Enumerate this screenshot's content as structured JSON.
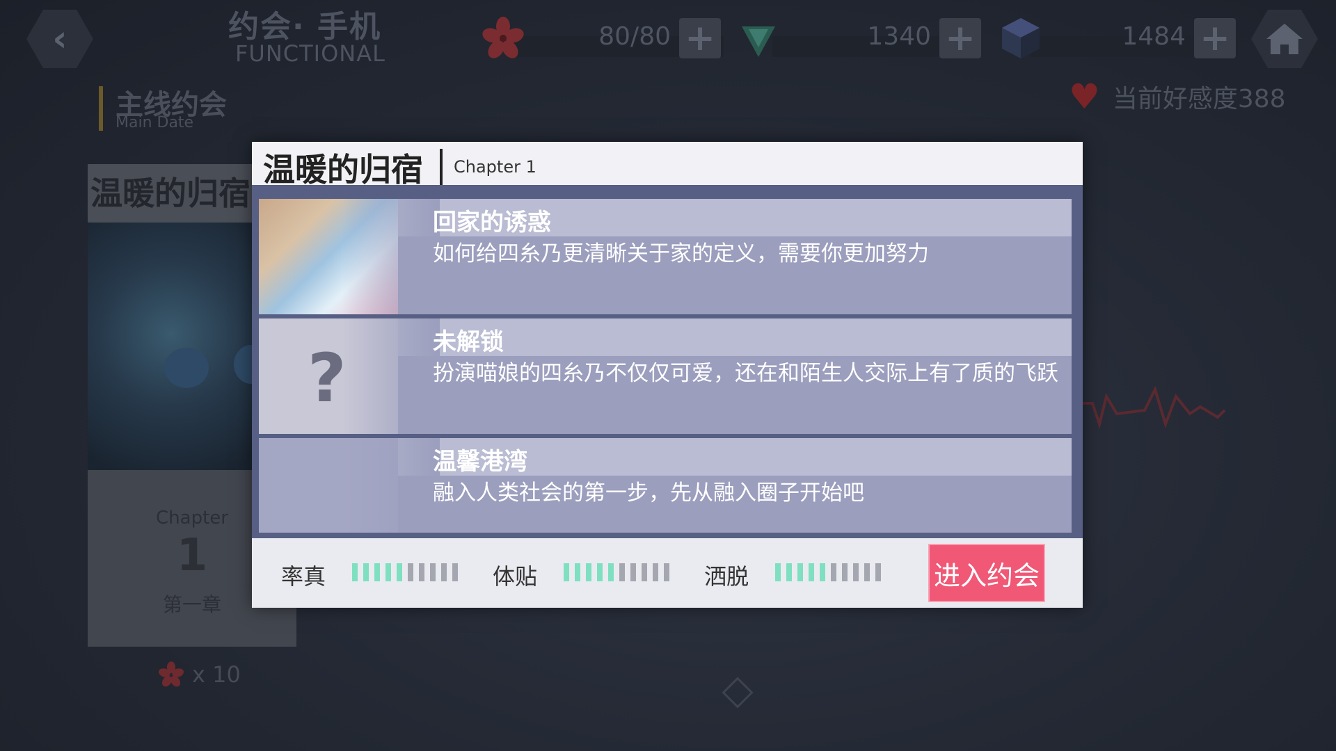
{
  "topbar": {
    "title_cn": "约会· 手机",
    "title_en": "FUNCTIONAL",
    "stamina": "80/80",
    "crystals": "1340",
    "cubes": "1484"
  },
  "section": {
    "title_cn": "主线约会",
    "title_en": "Main Date",
    "affection_label": "当前好感度388"
  },
  "chapter_card": {
    "title": "温暖的归宿",
    "chapter_label": "Chapter",
    "chapter_number": "1",
    "chapter_cn": "第一章",
    "cost": "x 10"
  },
  "modal": {
    "title": "温暖的归宿",
    "chapter": "Chapter 1",
    "episodes": [
      {
        "title": "回家的诱惑",
        "desc": "如何给四糸乃更清晰关于家的定义，需要你更加努力"
      },
      {
        "title": "未解锁",
        "desc": "扮演喵娘的四糸乃不仅仅可爱，还在和陌生人交际上有了质的飞跃"
      },
      {
        "title": "温馨港湾",
        "desc": "融入人类社会的第一步，先从融入圈子开始吧"
      }
    ],
    "stats": [
      {
        "label": "率真",
        "filled": 5,
        "total": 10
      },
      {
        "label": "体贴",
        "filled": 5,
        "total": 10
      },
      {
        "label": "洒脱",
        "filled": 5,
        "total": 10
      }
    ],
    "enter_label": "进入约会"
  },
  "colors": {
    "enter_button": "#f05876",
    "stat_on": "#7ee0c0",
    "stat_off": "#a5a7b0"
  }
}
